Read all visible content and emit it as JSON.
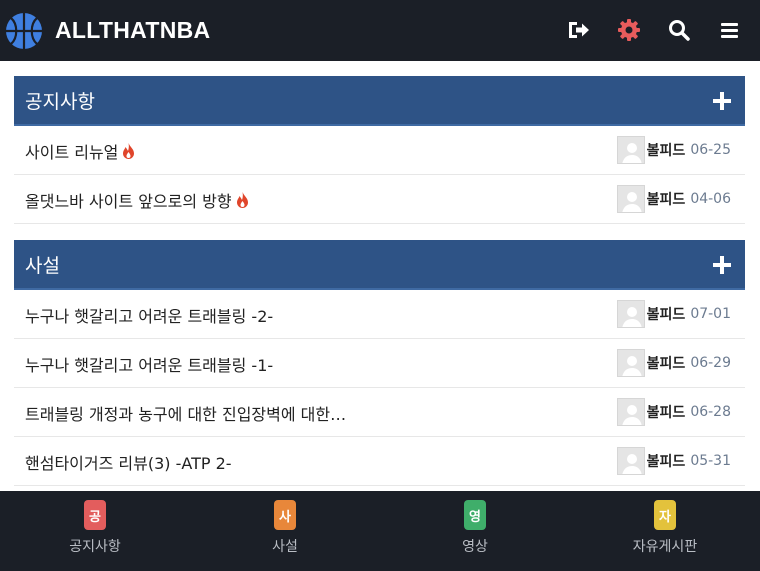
{
  "header": {
    "brand": "ALLTHATNBA",
    "icons": [
      "basketball-logo-icon",
      "logout-icon",
      "gear-icon",
      "search-icon",
      "hamburger-menu-icon"
    ],
    "accent_color": "#e85c5c"
  },
  "sections": [
    {
      "title": "공지사항",
      "posts": [
        {
          "title": "사이트 리뉴얼",
          "hot": true,
          "author": "볼피드",
          "date": "06-25"
        },
        {
          "title": "올댓느바 사이트 앞으로의 방향",
          "hot": true,
          "author": "볼피드",
          "date": "04-06"
        }
      ]
    },
    {
      "title": "사설",
      "posts": [
        {
          "title": "누구나 햇갈리고 어려운 트래블링 -2-",
          "hot": false,
          "author": "볼피드",
          "date": "07-01"
        },
        {
          "title": "누구나 햇갈리고 어려운 트래블링 -1-",
          "hot": false,
          "author": "볼피드",
          "date": "06-29"
        },
        {
          "title": "트래블링 개정과 농구에 대한 진입장벽에 대한…",
          "hot": false,
          "author": "볼피드",
          "date": "06-28"
        },
        {
          "title": "핸섬타이거즈 리뷰(3) -ATP 2-",
          "hot": false,
          "author": "볼피드",
          "date": "05-31"
        }
      ]
    }
  ],
  "bottom_nav": [
    {
      "badge": "공",
      "label": "공지사항",
      "color": "#e35d5d"
    },
    {
      "badge": "사",
      "label": "사설",
      "color": "#e8873a"
    },
    {
      "badge": "영",
      "label": "영상",
      "color": "#3fae6a"
    },
    {
      "badge": "자",
      "label": "자유게시판",
      "color": "#e3c23c"
    }
  ]
}
